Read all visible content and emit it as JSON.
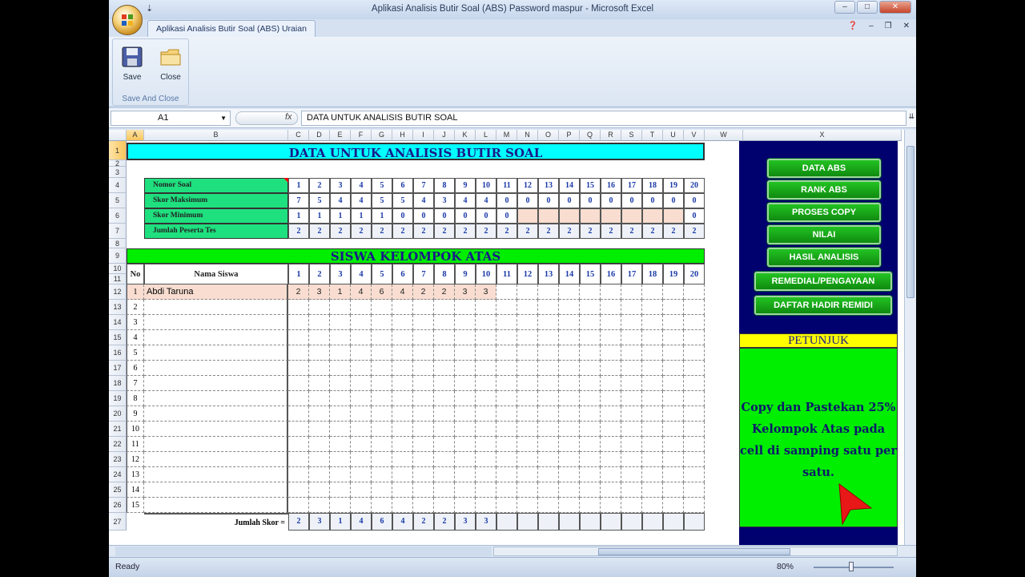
{
  "window": {
    "title": "Aplikasi Analisis Butir Soal (ABS) Password maspur - Microsoft Excel",
    "qat_mark": "⇣"
  },
  "ribbon": {
    "tab": "Aplikasi Analisis Butir Soal (ABS) Uraian",
    "group_label": "Save And Close",
    "save_label": "Save",
    "close_label": "Close"
  },
  "formula_bar": {
    "name_box": "A1",
    "fx": "fx",
    "formula": "DATA UNTUK ANALISIS BUTIR SOAL"
  },
  "columns": [
    "A",
    "B",
    "C",
    "D",
    "E",
    "F",
    "G",
    "H",
    "I",
    "J",
    "K",
    "L",
    "M",
    "N",
    "O",
    "P",
    "Q",
    "R",
    "S",
    "T",
    "U",
    "V",
    "W",
    "X"
  ],
  "rows": [
    "1",
    "2",
    "3",
    "4",
    "5",
    "6",
    "7",
    "8",
    "9",
    "10",
    "11",
    "12",
    "13",
    "14",
    "15",
    "16",
    "17",
    "18",
    "19",
    "20",
    "21",
    "22",
    "23",
    "24",
    "25",
    "26",
    "27"
  ],
  "sheet": {
    "header_banner": "DATA UNTUK ANALISIS BUTIR SOAL",
    "info_rows": [
      {
        "label": "Nomor Soal",
        "values": [
          "1",
          "2",
          "3",
          "4",
          "5",
          "6",
          "7",
          "8",
          "9",
          "10",
          "11",
          "12",
          "13",
          "14",
          "15",
          "16",
          "17",
          "18",
          "19",
          "20"
        ]
      },
      {
        "label": "Skor Maksimum",
        "values": [
          "7",
          "5",
          "4",
          "4",
          "5",
          "5",
          "4",
          "3",
          "4",
          "4",
          "0",
          "0",
          "0",
          "0",
          "0",
          "0",
          "0",
          "0",
          "0",
          "0"
        ]
      },
      {
        "label": "Skor Minimum",
        "values": [
          "1",
          "1",
          "1",
          "1",
          "1",
          "0",
          "0",
          "0",
          "0",
          "0",
          "0",
          "",
          "",
          "",
          "",
          "",
          "",
          "",
          "",
          "0"
        ]
      },
      {
        "label": "Jumlah Peserta Tes",
        "values": [
          "2",
          "2",
          "2",
          "2",
          "2",
          "2",
          "2",
          "2",
          "2",
          "2",
          "2",
          "2",
          "2",
          "2",
          "2",
          "2",
          "2",
          "2",
          "2",
          "2"
        ]
      }
    ],
    "group_banner": "SISWA KELOMPOK ATAS",
    "table": {
      "no_header": "No",
      "name_header": "Nama Siswa",
      "item_headers": [
        "1",
        "2",
        "3",
        "4",
        "5",
        "6",
        "7",
        "8",
        "9",
        "10",
        "11",
        "12",
        "13",
        "14",
        "15",
        "16",
        "17",
        "18",
        "19",
        "20"
      ],
      "students": [
        {
          "no": "1",
          "name": "Abdi Taruna",
          "scores": [
            "2",
            "3",
            "1",
            "4",
            "6",
            "4",
            "2",
            "2",
            "3",
            "3"
          ]
        },
        {
          "no": "2",
          "name": "",
          "scores": []
        },
        {
          "no": "3",
          "name": "",
          "scores": []
        },
        {
          "no": "4",
          "name": "",
          "scores": []
        },
        {
          "no": "5",
          "name": "",
          "scores": []
        },
        {
          "no": "6",
          "name": "",
          "scores": []
        },
        {
          "no": "7",
          "name": "",
          "scores": []
        },
        {
          "no": "8",
          "name": "",
          "scores": []
        },
        {
          "no": "9",
          "name": "",
          "scores": []
        },
        {
          "no": "10",
          "name": "",
          "scores": []
        },
        {
          "no": "11",
          "name": "",
          "scores": []
        },
        {
          "no": "12",
          "name": "",
          "scores": []
        },
        {
          "no": "13",
          "name": "",
          "scores": []
        },
        {
          "no": "14",
          "name": "",
          "scores": []
        },
        {
          "no": "15",
          "name": "",
          "scores": []
        }
      ],
      "total_label": "Jumlah Skor =",
      "totals": [
        "2",
        "3",
        "1",
        "4",
        "6",
        "4",
        "2",
        "2",
        "3",
        "3"
      ]
    }
  },
  "side_panel": {
    "buttons": [
      "DATA ABS",
      "RANK ABS",
      "PROSES COPY",
      "NILAI",
      "HASIL ANALISIS",
      "REMEDIAL/PENGAYAAN",
      "DAFTAR HADIR REMIDI"
    ],
    "petunjuk_title": "PETUNJUK",
    "petunjuk_text": "Copy dan Pastekan 25% Kelompok Atas pada cell di samping satu per satu."
  },
  "status_bar": {
    "ready": "Ready",
    "zoom": "80%"
  },
  "colors": {
    "banner_cyan": "#00ffff",
    "banner_green": "#00ee00",
    "label_green": "#1fe07f",
    "panel_navy": "#00006e",
    "petunjuk_yellow": "#ffff00",
    "number_blue": "#1a3aa8"
  }
}
